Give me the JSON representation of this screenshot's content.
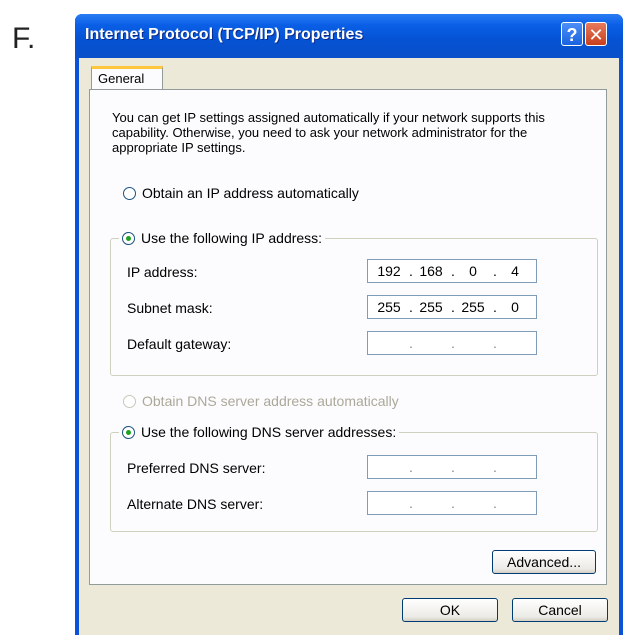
{
  "figure_label": "F.",
  "window": {
    "title": "Internet Protocol (TCP/IP) Properties",
    "help_glyph": "?",
    "close_glyph": "✕"
  },
  "tabs": [
    {
      "label": "General"
    }
  ],
  "description": "You can get IP settings assigned automatically if your network supports this capability. Otherwise, you need to ask your network administrator for the appropriate IP settings.",
  "ip_section": {
    "auto_option": {
      "label": "Obtain an IP address automatically",
      "selected": false
    },
    "manual_option": {
      "label": "Use the following IP address:",
      "selected": true
    },
    "fields": [
      {
        "label": "IP address:",
        "octets": [
          "192",
          "168",
          "0",
          "4"
        ]
      },
      {
        "label": "Subnet mask:",
        "octets": [
          "255",
          "255",
          "255",
          "0"
        ]
      },
      {
        "label": "Default gateway:",
        "octets": [
          "",
          "",
          "",
          ""
        ]
      }
    ]
  },
  "dns_section": {
    "auto_option": {
      "label": "Obtain DNS server address automatically",
      "selected": false,
      "enabled": false
    },
    "manual_option": {
      "label": "Use the following DNS server addresses:",
      "selected": true
    },
    "fields": [
      {
        "label": "Preferred DNS server:",
        "octets": [
          "",
          "",
          "",
          ""
        ]
      },
      {
        "label": "Alternate DNS server:",
        "octets": [
          "",
          "",
          "",
          ""
        ]
      }
    ]
  },
  "buttons": {
    "advanced": "Advanced...",
    "ok": "OK",
    "cancel": "Cancel"
  },
  "colors": {
    "titlebar": "#0a53d8",
    "dialog_bg": "#ece9d8",
    "selected_radio": "#21a121"
  }
}
